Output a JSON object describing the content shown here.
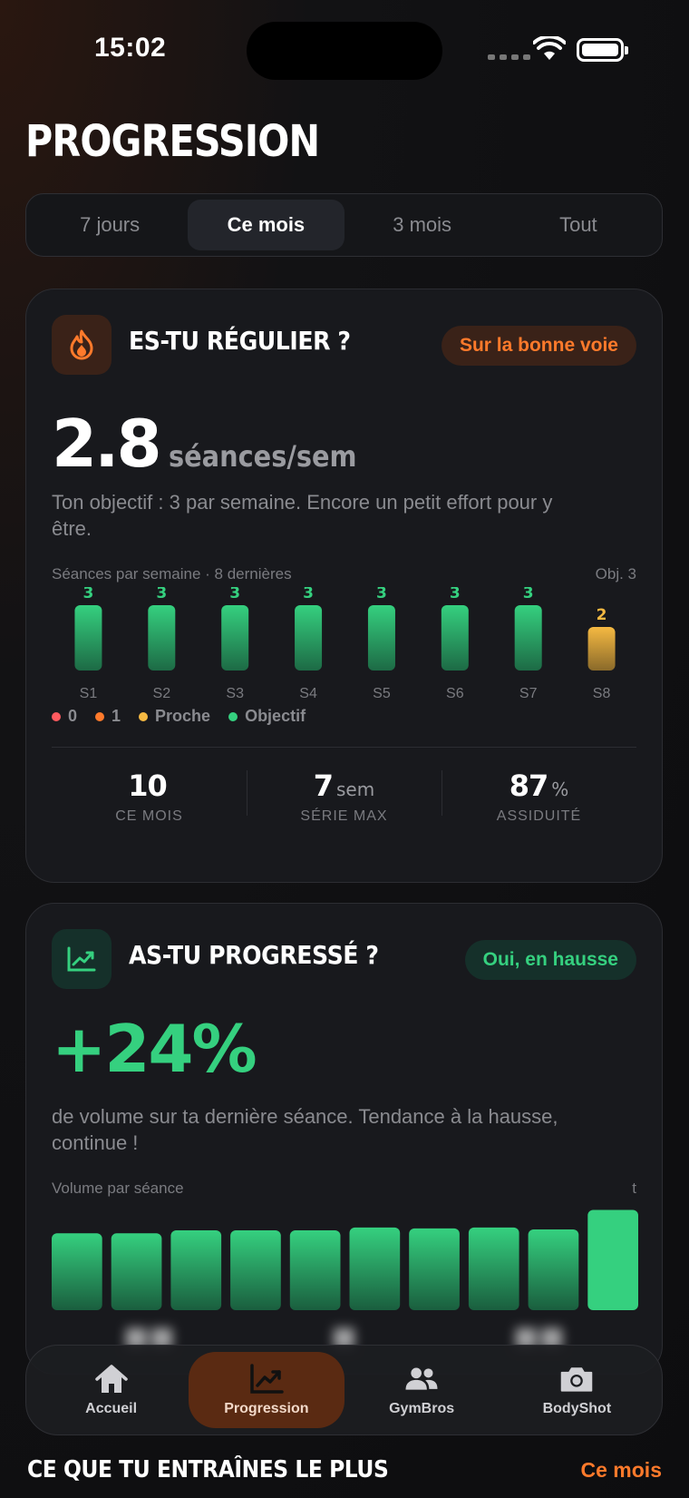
{
  "status": {
    "time": "15:02"
  },
  "page": {
    "title": "PROGRESSION"
  },
  "periods": [
    "7 jours",
    "Ce mois",
    "3 mois",
    "Tout"
  ],
  "consistency": {
    "title": "ES-TU RÉGULIER ?",
    "badge": "Sur la bonne voie",
    "value": "2.8",
    "unit": "séances/sem",
    "description": "Ton objectif : 3 par semaine. Encore un petit effort pour y être.",
    "chart_caption": "Séances par semaine · 8 dernières",
    "chart_goal": "Obj. 3",
    "legend": [
      "0",
      "1",
      "Proche",
      "Objectif"
    ],
    "stats": [
      {
        "value": "10",
        "unit": "",
        "label": "CE MOIS"
      },
      {
        "value": "7",
        "unit": "sem",
        "label": "SÉRIE MAX"
      },
      {
        "value": "87",
        "unit": "%",
        "label": "ASSIDUITÉ"
      }
    ]
  },
  "progress": {
    "title": "AS-TU PROGRESSÉ ?",
    "badge": "Oui, en hausse",
    "value": "+24%",
    "description": "de volume sur ta dernière séance. Tendance à la hausse, continue !",
    "chart_caption": "Volume par séance",
    "chart_unit": "t"
  },
  "chart_data": [
    {
      "type": "bar",
      "categories": [
        "S1",
        "S2",
        "S3",
        "S4",
        "S5",
        "S6",
        "S7",
        "S8"
      ],
      "values": [
        3,
        3,
        3,
        3,
        3,
        3,
        3,
        2
      ],
      "data_labels": [
        "3",
        "3",
        "3",
        "3",
        "3",
        "3",
        "3",
        "2"
      ],
      "ylim": [
        0,
        3
      ],
      "colors": {
        "goal": "#35d07f",
        "close": "#f5b942"
      }
    },
    {
      "type": "bar",
      "values": [
        0.79,
        0.79,
        0.82,
        0.82,
        0.82,
        0.85,
        0.84,
        0.85,
        0.83,
        1.03
      ],
      "ylim": [
        0,
        1.1
      ],
      "colors": {
        "bar": "#35d07f",
        "latest": "#35d07f"
      }
    }
  ],
  "colors": {
    "accent": "#ff7a2b",
    "green": "#35d07f",
    "red": "#ff5a5f",
    "yellow": "#f5b942"
  },
  "tabbar": [
    {
      "label": "Accueil",
      "icon": "home-icon"
    },
    {
      "label": "Progression",
      "icon": "chart-trend-icon"
    },
    {
      "label": "GymBros",
      "icon": "users-icon"
    },
    {
      "label": "BodyShot",
      "icon": "camera-icon"
    }
  ],
  "bottom": {
    "title": "CE QUE TU ENTRAÎNES LE PLUS",
    "link": "Ce mois"
  }
}
